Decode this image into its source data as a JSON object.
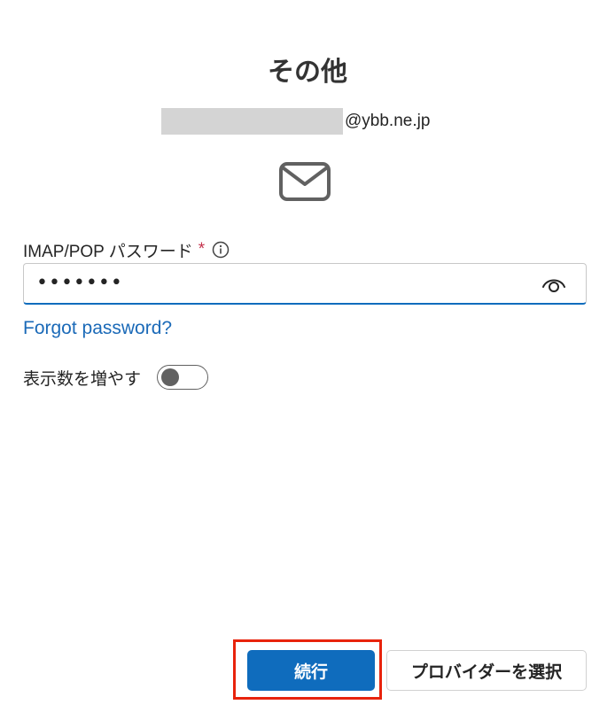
{
  "header": {
    "title": "その他"
  },
  "account": {
    "domain": "@ybb.ne.jp"
  },
  "icons": {
    "mail": "mail-icon",
    "info": "info-icon",
    "eye": "eye-icon"
  },
  "password_field": {
    "label": "IMAP/POP パスワード",
    "required_marker": "*",
    "value": "•••••••"
  },
  "forgot_password": {
    "label": "Forgot password?"
  },
  "more_settings": {
    "label": "表示数を増やす",
    "enabled": false
  },
  "actions": {
    "continue_label": "続行",
    "choose_provider_label": "プロバイダーを選択"
  },
  "colors": {
    "accent": "#0f6cbd",
    "link": "#1b6ab8",
    "required": "#c4314b",
    "highlight": "#e8230c",
    "redaction": "#d4d4d4"
  }
}
